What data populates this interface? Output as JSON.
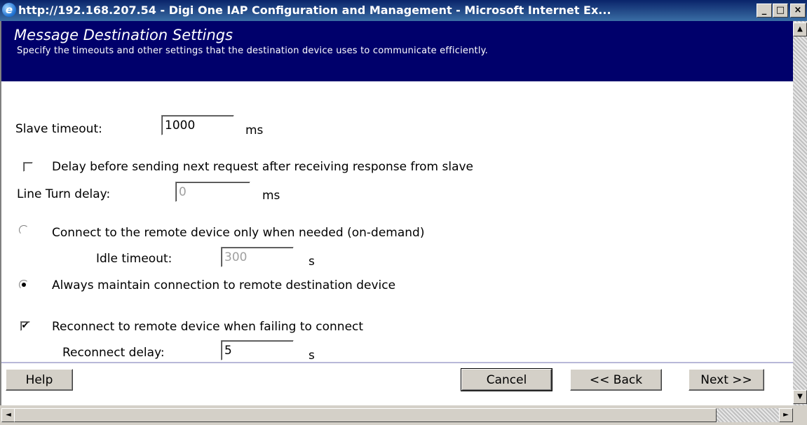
{
  "window": {
    "title": "http://192.168.207.54 - Digi One IAP Configuration and Management - Microsoft Internet Ex...",
    "minimize": "_",
    "maximize": "□",
    "close": "×"
  },
  "header": {
    "title": "Message Destination Settings",
    "subtitle": "Specify the timeouts and other settings that the destination device uses to communicate efficiently."
  },
  "form": {
    "slave_timeout": {
      "label": "Slave timeout:",
      "value": "1000",
      "unit": "ms"
    },
    "delay_checkbox": {
      "label": "Delay before sending next request after receiving response from slave",
      "checked": false
    },
    "line_turn_delay": {
      "label": "Line Turn delay:",
      "value": "0",
      "unit": "ms",
      "disabled": true
    },
    "on_demand_radio": {
      "label": "Connect to the remote device only when needed (on-demand)",
      "selected": false
    },
    "idle_timeout": {
      "label": "Idle timeout:",
      "value": "300",
      "unit": "s",
      "disabled": true
    },
    "always_radio": {
      "label": "Always maintain connection to remote destination device",
      "selected": true
    },
    "reconnect_checkbox": {
      "label": "Reconnect to remote device when failing to connect",
      "checked": true,
      "mark": "✔"
    },
    "reconnect_delay": {
      "label": "Reconnect delay:",
      "value": "5",
      "unit": "s"
    }
  },
  "footer": {
    "help": "Help",
    "cancel": "Cancel",
    "back": "<< Back",
    "next": "Next >>"
  },
  "scroll": {
    "up": "▲",
    "down": "▼",
    "left": "◄",
    "right": "►"
  }
}
